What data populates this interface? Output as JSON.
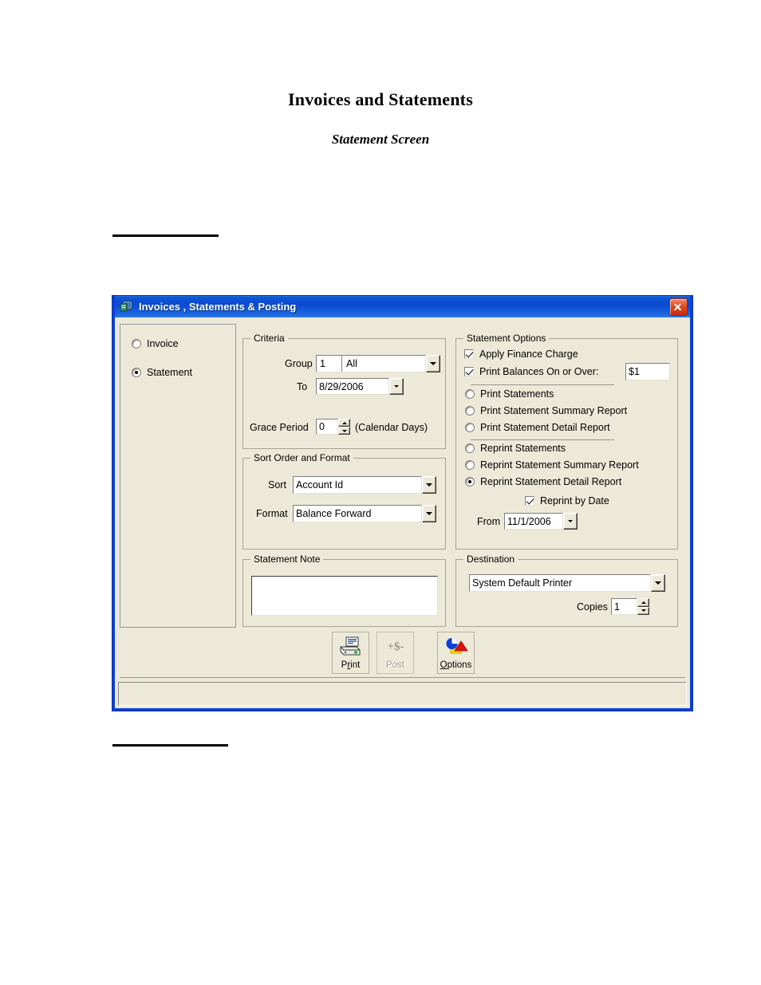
{
  "document": {
    "title": "Invoices and Statements",
    "subtitle": "Statement Screen"
  },
  "window": {
    "title": "Invoices , Statements & Posting",
    "icon": "application-icon",
    "close_label": "Close"
  },
  "doc_type_panel": {
    "options": [
      {
        "label": "Invoice",
        "selected": false
      },
      {
        "label": "Statement",
        "selected": true
      }
    ]
  },
  "criteria": {
    "title": "Criteria",
    "group_label": "Group",
    "group_id_value": "1",
    "group_name_value": "All",
    "to_label": "To",
    "to_value": "8/29/2006",
    "grace_label": "Grace Period",
    "grace_value": "0",
    "grace_suffix": "(Calendar Days)"
  },
  "sort_format": {
    "title": "Sort Order and Format",
    "sort_label": "Sort",
    "sort_value": "Account Id",
    "format_label": "Format",
    "format_value": "Balance Forward"
  },
  "statement_note": {
    "title": "Statement Note",
    "value": "",
    "placeholder": ""
  },
  "statement_options": {
    "title": "Statement Options",
    "apply_finance_charge": {
      "label": "Apply Finance Charge",
      "checked": true
    },
    "print_balances": {
      "label": "Print Balances On or Over:",
      "checked": true,
      "amount": "$1"
    },
    "print_group": [
      {
        "label": "Print Statements",
        "selected": false
      },
      {
        "label": "Print Statement Summary Report",
        "selected": false
      },
      {
        "label": "Print Statement Detail Report",
        "selected": false
      }
    ],
    "reprint_group": [
      {
        "label": "Reprint Statements",
        "selected": false
      },
      {
        "label": "Reprint Statement Summary Report",
        "selected": false
      },
      {
        "label": "Reprint Statement Detail Report",
        "selected": true
      }
    ],
    "reprint_by_date": {
      "label": "Reprint by Date",
      "checked": true
    },
    "from_label": "From",
    "from_value": "11/1/2006"
  },
  "destination": {
    "title": "Destination",
    "printer_value": "System Default Printer",
    "copies_label": "Copies",
    "copies_value": "1"
  },
  "toolbar": {
    "print": {
      "label_pre": "P",
      "label_accel": "r",
      "label_post": "int",
      "full": "Print",
      "icon": "printer-icon",
      "enabled": true
    },
    "post": {
      "full": "Post",
      "icon": "dollar-icon",
      "enabled": false
    },
    "options": {
      "full": "Options",
      "icon": "options-shapes-icon",
      "enabled": true
    }
  },
  "statusbar": {
    "text": ""
  },
  "colors": {
    "titlebar_blue": "#0a4ad2",
    "client_beige": "#ece9d8",
    "close_red": "#e04a22",
    "field_white": "#ffffff"
  }
}
